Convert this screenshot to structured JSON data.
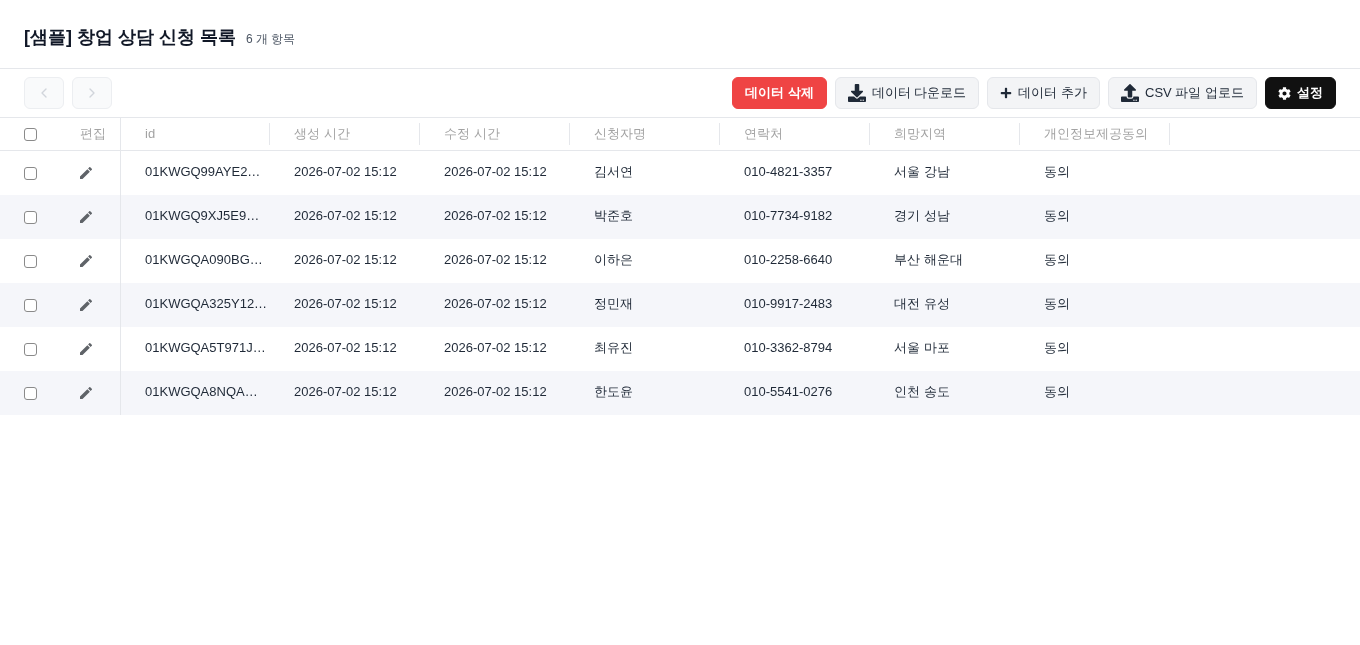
{
  "page": {
    "title": "[샘플] 창업 상담 신청 목록",
    "count": "6 개 항목"
  },
  "pager": {
    "previous": {
      "disabled": true
    },
    "next": {
      "disabled": true
    }
  },
  "actions": [
    {
      "label": "데이터 삭제",
      "kind": "danger"
    },
    {
      "label": "데이터 다운로드",
      "kind": "secondary"
    },
    {
      "label": "데이터 추가",
      "kind": "secondary"
    },
    {
      "label": "CSV 파일 업로드",
      "kind": "secondary"
    },
    {
      "label": "설정",
      "kind": "primary"
    }
  ],
  "table": {
    "select_all": {
      "checked": false
    },
    "edit_header": "편집",
    "columns": [
      "id",
      "생성 시간",
      "수정 시간",
      "신청자명",
      "연락처",
      "희망지역",
      "개인정보제공동의"
    ],
    "rows": [
      {
        "checked": false,
        "cells": [
          "01KWGQ99AYE2…",
          "2026-07-02 15:12",
          "2026-07-02 15:12",
          "김서연",
          "010-4821-3357",
          "서울 강남",
          "동의"
        ]
      },
      {
        "checked": false,
        "cells": [
          "01KWGQ9XJ5E9…",
          "2026-07-02 15:12",
          "2026-07-02 15:12",
          "박준호",
          "010-7734-9182",
          "경기 성남",
          "동의"
        ]
      },
      {
        "checked": false,
        "cells": [
          "01KWGQA090BG…",
          "2026-07-02 15:12",
          "2026-07-02 15:12",
          "이하은",
          "010-2258-6640",
          "부산 해운대",
          "동의"
        ]
      },
      {
        "checked": false,
        "cells": [
          "01KWGQA325Y12…",
          "2026-07-02 15:12",
          "2026-07-02 15:12",
          "정민재",
          "010-9917-2483",
          "대전 유성",
          "동의"
        ]
      },
      {
        "checked": false,
        "cells": [
          "01KWGQA5T971J…",
          "2026-07-02 15:12",
          "2026-07-02 15:12",
          "최유진",
          "010-3362-8794",
          "서울 마포",
          "동의"
        ]
      },
      {
        "checked": false,
        "cells": [
          "01KWGQA8NQA…",
          "2026-07-02 15:12",
          "2026-07-02 15:12",
          "한도윤",
          "010-5541-0276",
          "인천 송도",
          "동의"
        ]
      }
    ]
  }
}
